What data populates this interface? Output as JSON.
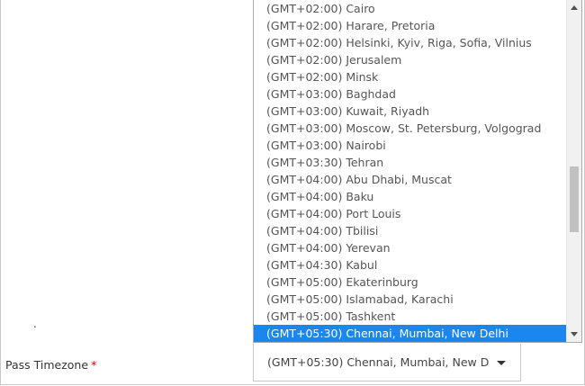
{
  "form": {
    "stray_mark": ".",
    "timezone_label": "Pass Timezone",
    "required_marker": "*",
    "selected_value": "(GMT+05:30) Chennai, Mumbai, New D"
  },
  "dropdown": {
    "options": [
      "(GMT+02:00) Cairo",
      "(GMT+02:00) Harare, Pretoria",
      "(GMT+02:00) Helsinki, Kyiv, Riga, Sofia, Vilnius",
      "(GMT+02:00) Jerusalem",
      "(GMT+02:00) Minsk",
      "(GMT+03:00) Baghdad",
      "(GMT+03:00) Kuwait, Riyadh",
      "(GMT+03:00) Moscow, St. Petersburg, Volgograd",
      "(GMT+03:00) Nairobi",
      "(GMT+03:30) Tehran",
      "(GMT+04:00) Abu Dhabi, Muscat",
      "(GMT+04:00) Baku",
      "(GMT+04:00) Port Louis",
      "(GMT+04:00) Tbilisi",
      "(GMT+04:00) Yerevan",
      "(GMT+04:30) Kabul",
      "(GMT+05:00) Ekaterinburg",
      "(GMT+05:00) Islamabad, Karachi",
      "(GMT+05:00) Tashkent",
      "(GMT+05:30) Chennai, Mumbai, New Delhi"
    ],
    "selected_index": 19,
    "highlight_color": "#1a87f0",
    "scroll_up_icon": "triangle-up-icon",
    "scroll_down_icon": "triangle-down-icon"
  }
}
